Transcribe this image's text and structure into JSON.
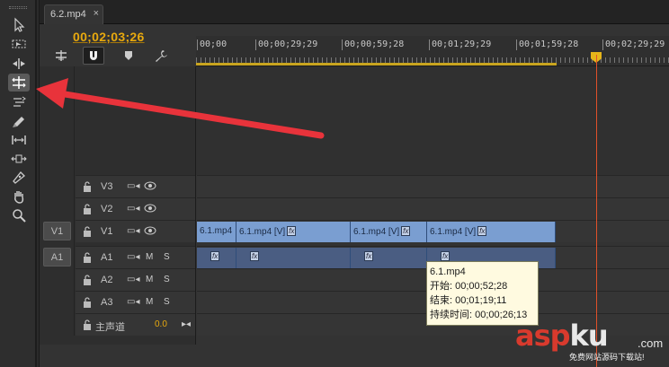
{
  "tab": {
    "label": "6.2.mp4",
    "close": "×"
  },
  "timecode": "00;02;03;26",
  "ruler": {
    "labels": [
      "00;00",
      "00;00;29;29",
      "00;00;59;28",
      "00;01;29;29",
      "00;01;59;28",
      "00;02;29;29"
    ]
  },
  "tracks": {
    "video": [
      {
        "name": "V3",
        "side": ""
      },
      {
        "name": "V2",
        "side": ""
      },
      {
        "name": "V1",
        "side": "V1"
      }
    ],
    "audio": [
      {
        "name": "A1",
        "side": "A1",
        "m": "M",
        "s": "S"
      },
      {
        "name": "A2",
        "side": "",
        "m": "M",
        "s": "S"
      },
      {
        "name": "A3",
        "side": "",
        "m": "M",
        "s": "S"
      }
    ],
    "master": {
      "name": "主声道",
      "value": "0.0"
    }
  },
  "clips": {
    "video": [
      "6.1.mp4",
      "6.1.mp4 [V]",
      "6.1.mp4 [V]",
      "6.1.mp4 [V]"
    ],
    "fx": "fx"
  },
  "tooltip": {
    "title": "6.1.mp4",
    "start": "开始: 00;00;52;28",
    "end": "结束: 00;01;19;11",
    "duration": "持续时间: 00;00;26;13"
  },
  "watermark": {
    "asp": "asp",
    "ku": "ku",
    "com": ".com",
    "sub": "免费网站源码下载站!"
  },
  "colors": {
    "timecode": "#e8a90e",
    "playhead": "#e0502a",
    "video_clip": "#7a9ed1",
    "audio_clip": "#4a5d82",
    "arrow": "#e8333b"
  }
}
